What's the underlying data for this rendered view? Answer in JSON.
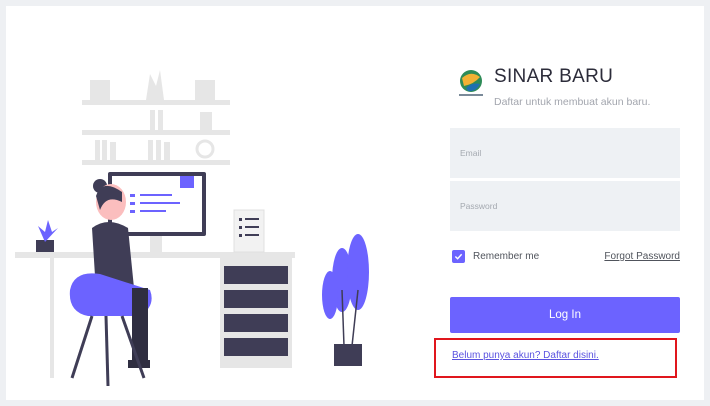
{
  "brand": {
    "logo_icon": "globe-logo-icon",
    "name": "SINAR BARU",
    "subtitle": "Daftar untuk membuat akun baru."
  },
  "form": {
    "email_placeholder": "Email",
    "email_value": "",
    "password_placeholder": "Password",
    "password_value": "",
    "remember_label": "Remember me",
    "remember_checked": true,
    "forgot_label": "Forgot Password",
    "login_label": "Log In",
    "signup_link": "Belum punya akun? Daftar disini."
  },
  "colors": {
    "accent": "#6c63ff",
    "highlight_border": "#e0161d",
    "input_bg": "#eef1f4"
  }
}
